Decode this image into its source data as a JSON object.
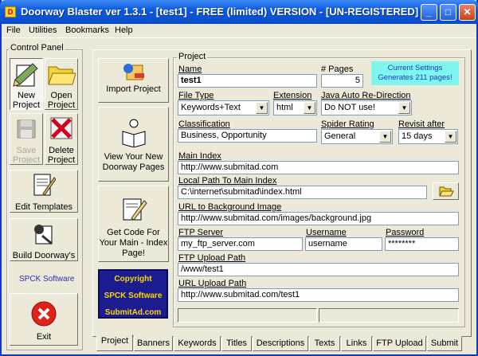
{
  "window": {
    "title": "Doorway Blaster ver 1.3.1 - [test1] - FREE (limited) VERSION - [UN-REGISTERED]",
    "minimize": "_",
    "maximize": "□",
    "close": "✕"
  },
  "menu": [
    "File",
    "Utilities",
    "Bookmarks",
    "Help"
  ],
  "control_panel": {
    "legend": "Control Panel",
    "new_project": "New Project",
    "open_project": "Open Project",
    "save_project": "Save Project",
    "delete_project": "Delete Project",
    "edit_templates": "Edit Templates",
    "build_doorways": "Build Doorway's",
    "spck": "SPCK Software",
    "exit": "Exit"
  },
  "side_buttons": {
    "import_project": "Import Project",
    "view_pages": "View Your New Doorway Pages",
    "get_code": "Get Code For Your Main - Index Page!",
    "badge_line1": "Copyright",
    "badge_line2": "SPCK Software",
    "badge_line3": "SubmitAd.com"
  },
  "project": {
    "legend": "Project",
    "name_label": "Name",
    "name_value": "test1",
    "pages_label": "# Pages",
    "pages_value": "5",
    "settings_line1": "Current Settings",
    "settings_line2": "Generates  211 pages!",
    "filetype_label": "File Type",
    "filetype_value": "Keywords+Text",
    "extension_label": "Extension",
    "extension_value": "html",
    "java_label": "Java Auto Re-Direction",
    "java_value": "Do NOT use!",
    "classification_label": "Classification",
    "classification_value": "Business, Opportunity",
    "spider_label": "Spider Rating",
    "spider_value": "General",
    "revisit_label": "Revisit after",
    "revisit_value": "15 days",
    "main_index_label": "Main Index",
    "main_index_value": "http://www.submitad.com",
    "local_path_label": "Local Path To Main Index",
    "local_path_value": "C:\\internet\\submitad\\index.html",
    "bg_label": "URL to Background Image",
    "bg_value": "http://www.submitad.com/images/background.jpg",
    "ftp_server_label": "FTP Server",
    "ftp_server_value": "my_ftp_server.com",
    "username_label": "Username",
    "username_value": "username",
    "password_label": "Password",
    "password_value": "********",
    "ftp_path_label": "FTP Upload Path",
    "ftp_path_value": "/www/test1",
    "url_upload_label": "URL Upload Path",
    "url_upload_value": "http://www.submitad.com/test1"
  },
  "tabs": [
    "Project",
    "Banners",
    "Keywords",
    "Titles",
    "Descriptions",
    "Texts",
    "Links",
    "FTP Upload",
    "Submit"
  ]
}
